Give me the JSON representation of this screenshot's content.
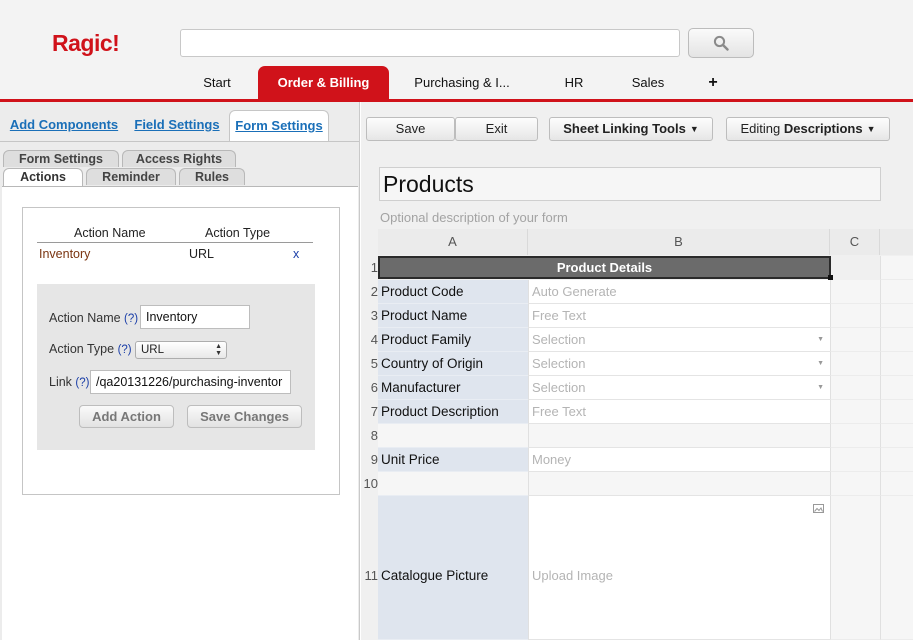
{
  "app": {
    "logo": "Ragic!"
  },
  "nav": {
    "tabs": [
      {
        "label": "Start"
      },
      {
        "label": "Order & Billing",
        "active": true
      },
      {
        "label": "Purchasing & I..."
      },
      {
        "label": "HR"
      },
      {
        "label": "Sales"
      },
      {
        "label": "+"
      }
    ]
  },
  "left": {
    "main_tabs": [
      {
        "label": "Add Components"
      },
      {
        "label": "Field Settings"
      },
      {
        "label": "Form Settings",
        "active": true
      }
    ],
    "sub_tabs": [
      {
        "label": "Form Settings"
      },
      {
        "label": "Access Rights"
      },
      {
        "label": "Actions",
        "active": true
      },
      {
        "label": "Reminder"
      },
      {
        "label": "Rules"
      }
    ],
    "actions_table": {
      "headers": [
        "Action Name",
        "Action Type"
      ],
      "rows": [
        {
          "name": "Inventory",
          "type": "URL",
          "delete": "x"
        }
      ]
    },
    "form": {
      "name_label": "Action Name",
      "type_label": "Action Type",
      "link_label": "Link",
      "help": "(?)",
      "name_value": "Inventory",
      "type_value": "URL",
      "link_value": "/qa20131226/purchasing-inventor",
      "add_button": "Add Action",
      "save_button": "Save Changes"
    }
  },
  "toolbar": {
    "save": "Save",
    "exit": "Exit",
    "sheet_linking": "Sheet Linking Tools",
    "editing_prefix": "Editing",
    "editing_mode": "Descriptions"
  },
  "sheet": {
    "title": "Products",
    "description": "Optional description of your form",
    "columns": [
      "A",
      "B",
      "C"
    ],
    "header_cell": "Product Details",
    "rows": [
      {
        "num": "1"
      },
      {
        "num": "2",
        "label": "Product Code",
        "hint": "Auto Generate"
      },
      {
        "num": "3",
        "label": "Product Name",
        "hint": "Free Text"
      },
      {
        "num": "4",
        "label": "Product Family",
        "hint": "Selection"
      },
      {
        "num": "5",
        "label": "Country of Origin",
        "hint": "Selection"
      },
      {
        "num": "6",
        "label": "Manufacturer",
        "hint": "Selection"
      },
      {
        "num": "7",
        "label": "Product Description",
        "hint": "Free Text"
      },
      {
        "num": "8",
        "label": "",
        "hint": ""
      },
      {
        "num": "9",
        "label": "Unit Price",
        "hint": "Money"
      },
      {
        "num": "10",
        "label": "",
        "hint": ""
      },
      {
        "num": "11",
        "label": "Catalogue Picture",
        "hint": "Upload Image"
      }
    ]
  },
  "colors": {
    "brand": "#d0121a",
    "link": "#1a6fb8",
    "label_cell": "#dfe5ee",
    "hint_text": "#b4b4b4"
  },
  "icons": {
    "search": "magnifier-icon",
    "dropdown": "caret-down-icon",
    "image": "image-icon"
  }
}
